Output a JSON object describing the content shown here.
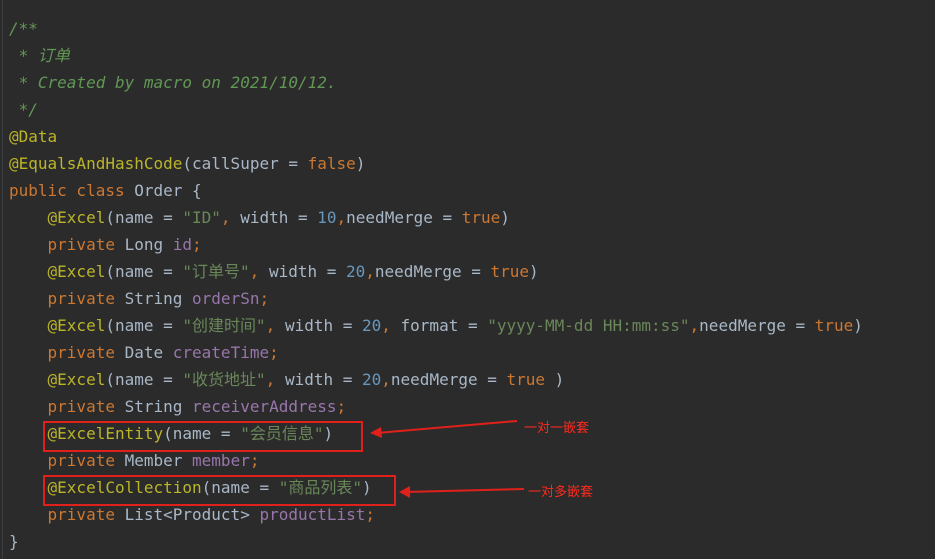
{
  "code": {
    "lines": [
      [
        {
          "t": "/**",
          "c": "cm"
        }
      ],
      [
        {
          "t": " * 订单",
          "c": "cm"
        }
      ],
      [
        {
          "t": " * Created by macro on 2021/10/12.",
          "c": "cm"
        }
      ],
      [
        {
          "t": " */",
          "c": "cm"
        }
      ],
      [
        {
          "t": "@Data",
          "c": "an"
        }
      ],
      [
        {
          "t": "@EqualsAndHashCode",
          "c": "an"
        },
        {
          "t": "(callSuper = ",
          "c": "pl"
        },
        {
          "t": "false",
          "c": "kw"
        },
        {
          "t": ")",
          "c": "pl"
        }
      ],
      [
        {
          "t": "public class ",
          "c": "kw"
        },
        {
          "t": "Order {",
          "c": "pl"
        }
      ],
      [
        {
          "t": "    ",
          "c": "pl"
        },
        {
          "t": "@Excel",
          "c": "an"
        },
        {
          "t": "(name = ",
          "c": "pl"
        },
        {
          "t": "\"ID\"",
          "c": "st"
        },
        {
          "t": ", ",
          "c": "kw"
        },
        {
          "t": "width = ",
          "c": "pl"
        },
        {
          "t": "10",
          "c": "nu"
        },
        {
          "t": ",",
          "c": "kw"
        },
        {
          "t": "needMerge = ",
          "c": "pl"
        },
        {
          "t": "true",
          "c": "kw"
        },
        {
          "t": ")",
          "c": "pl"
        }
      ],
      [
        {
          "t": "    ",
          "c": "pl"
        },
        {
          "t": "private ",
          "c": "kw"
        },
        {
          "t": "Long ",
          "c": "pl"
        },
        {
          "t": "id",
          "c": "fd"
        },
        {
          "t": ";",
          "c": "kw"
        }
      ],
      [
        {
          "t": "    ",
          "c": "pl"
        },
        {
          "t": "@Excel",
          "c": "an"
        },
        {
          "t": "(name = ",
          "c": "pl"
        },
        {
          "t": "\"订单号\"",
          "c": "st"
        },
        {
          "t": ", ",
          "c": "kw"
        },
        {
          "t": "width = ",
          "c": "pl"
        },
        {
          "t": "20",
          "c": "nu"
        },
        {
          "t": ",",
          "c": "kw"
        },
        {
          "t": "needMerge = ",
          "c": "pl"
        },
        {
          "t": "true",
          "c": "kw"
        },
        {
          "t": ")",
          "c": "pl"
        }
      ],
      [
        {
          "t": "    ",
          "c": "pl"
        },
        {
          "t": "private ",
          "c": "kw"
        },
        {
          "t": "String ",
          "c": "pl"
        },
        {
          "t": "orderSn",
          "c": "fd"
        },
        {
          "t": ";",
          "c": "kw"
        }
      ],
      [
        {
          "t": "    ",
          "c": "pl"
        },
        {
          "t": "@Excel",
          "c": "an"
        },
        {
          "t": "(name = ",
          "c": "pl"
        },
        {
          "t": "\"创建时间\"",
          "c": "st"
        },
        {
          "t": ", ",
          "c": "kw"
        },
        {
          "t": "width = ",
          "c": "pl"
        },
        {
          "t": "20",
          "c": "nu"
        },
        {
          "t": ", ",
          "c": "kw"
        },
        {
          "t": "format = ",
          "c": "pl"
        },
        {
          "t": "\"yyyy-MM-dd HH:mm:ss\"",
          "c": "st"
        },
        {
          "t": ",",
          "c": "kw"
        },
        {
          "t": "needMerge = ",
          "c": "pl"
        },
        {
          "t": "true",
          "c": "kw"
        },
        {
          "t": ")",
          "c": "pl"
        }
      ],
      [
        {
          "t": "    ",
          "c": "pl"
        },
        {
          "t": "private ",
          "c": "kw"
        },
        {
          "t": "Date ",
          "c": "pl"
        },
        {
          "t": "createTime",
          "c": "fd"
        },
        {
          "t": ";",
          "c": "kw"
        }
      ],
      [
        {
          "t": "    ",
          "c": "pl"
        },
        {
          "t": "@Excel",
          "c": "an"
        },
        {
          "t": "(name = ",
          "c": "pl"
        },
        {
          "t": "\"收货地址\"",
          "c": "st"
        },
        {
          "t": ", ",
          "c": "kw"
        },
        {
          "t": "width = ",
          "c": "pl"
        },
        {
          "t": "20",
          "c": "nu"
        },
        {
          "t": ",",
          "c": "kw"
        },
        {
          "t": "needMerge = ",
          "c": "pl"
        },
        {
          "t": "true ",
          "c": "kw"
        },
        {
          "t": ")",
          "c": "pl"
        }
      ],
      [
        {
          "t": "    ",
          "c": "pl"
        },
        {
          "t": "private ",
          "c": "kw"
        },
        {
          "t": "String ",
          "c": "pl"
        },
        {
          "t": "receiverAddress",
          "c": "fd"
        },
        {
          "t": ";",
          "c": "kw"
        }
      ],
      [
        {
          "t": "    ",
          "c": "pl"
        },
        {
          "t": "@ExcelEntity",
          "c": "an"
        },
        {
          "t": "(name = ",
          "c": "pl"
        },
        {
          "t": "\"会员信息\"",
          "c": "st"
        },
        {
          "t": ")",
          "c": "pl"
        }
      ],
      [
        {
          "t": "    ",
          "c": "pl"
        },
        {
          "t": "private ",
          "c": "kw"
        },
        {
          "t": "Member ",
          "c": "pl"
        },
        {
          "t": "member",
          "c": "fd"
        },
        {
          "t": ";",
          "c": "kw"
        }
      ],
      [
        {
          "t": "    ",
          "c": "pl"
        },
        {
          "t": "@ExcelCollection",
          "c": "an"
        },
        {
          "t": "(name = ",
          "c": "pl"
        },
        {
          "t": "\"商品列表\"",
          "c": "st"
        },
        {
          "t": ")",
          "c": "pl"
        }
      ],
      [
        {
          "t": "    ",
          "c": "pl"
        },
        {
          "t": "private ",
          "c": "kw"
        },
        {
          "t": "List<Product> ",
          "c": "pl"
        },
        {
          "t": "productList",
          "c": "fd"
        },
        {
          "t": ";",
          "c": "kw"
        }
      ],
      [
        {
          "t": "}",
          "c": "pl"
        }
      ]
    ]
  },
  "annotations": {
    "one_to_one": "一对一嵌套",
    "one_to_many": "一对多嵌套",
    "color": "#e0201a"
  },
  "theme": {
    "background": "#2b2b2b",
    "comment": "#629755",
    "annotation": "#bbb529",
    "keyword": "#cc7832",
    "string": "#6a8759",
    "number": "#6897bb",
    "field": "#9876aa",
    "plain": "#a9b7c6"
  }
}
